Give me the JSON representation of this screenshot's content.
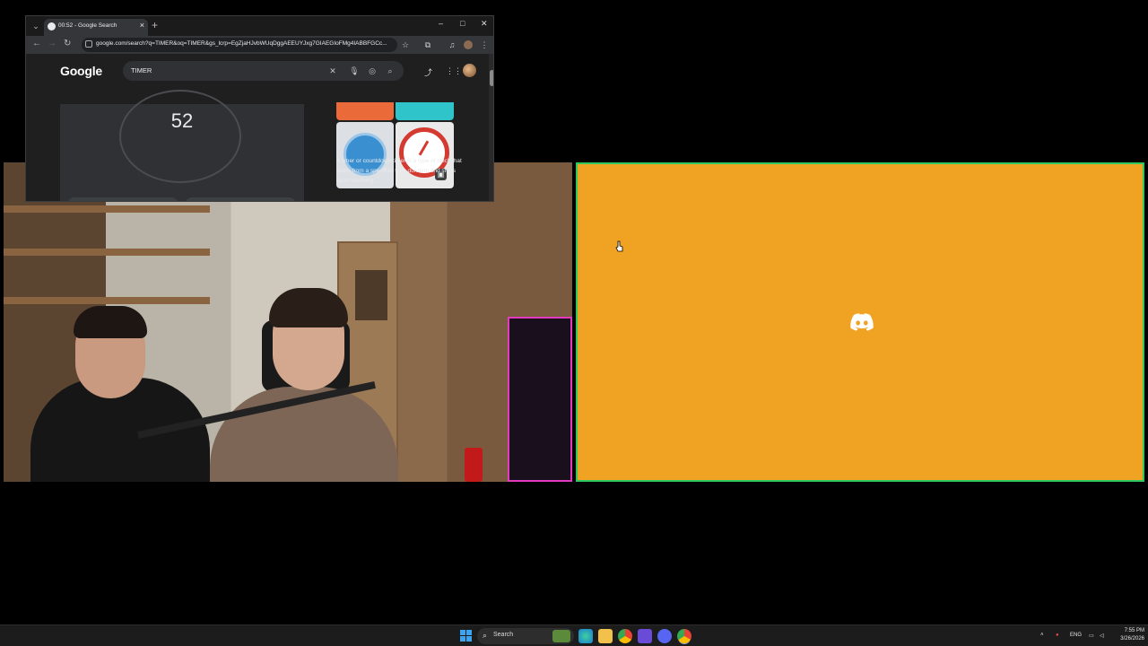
{
  "browser": {
    "tab_title": "00:52 - Google Search",
    "url": "google.com/search?q=TIMER&oq=TIMER&gs_lcrp=EgZjaHJvbWUqDggAEEUYJxg7GIAEGIoFMg4IABBFGCc...",
    "search_query": "TIMER",
    "logo_text": "Google"
  },
  "timer": {
    "display": "52",
    "pause_symbol": "⏸",
    "reset_symbol": "↻"
  },
  "knowledge_panel": {
    "description": "A timer or countdown timer is a type of clock that starts from a specified time duration and stops upon reaching..."
  },
  "taskbar": {
    "search_label": "Search",
    "language": "ENG",
    "time": "7:55 PM",
    "date": "3/26/2026"
  },
  "colors": {
    "discord_tile": "#f0a322",
    "tile_border": "#2ec760",
    "browser_bg": "#202124"
  }
}
